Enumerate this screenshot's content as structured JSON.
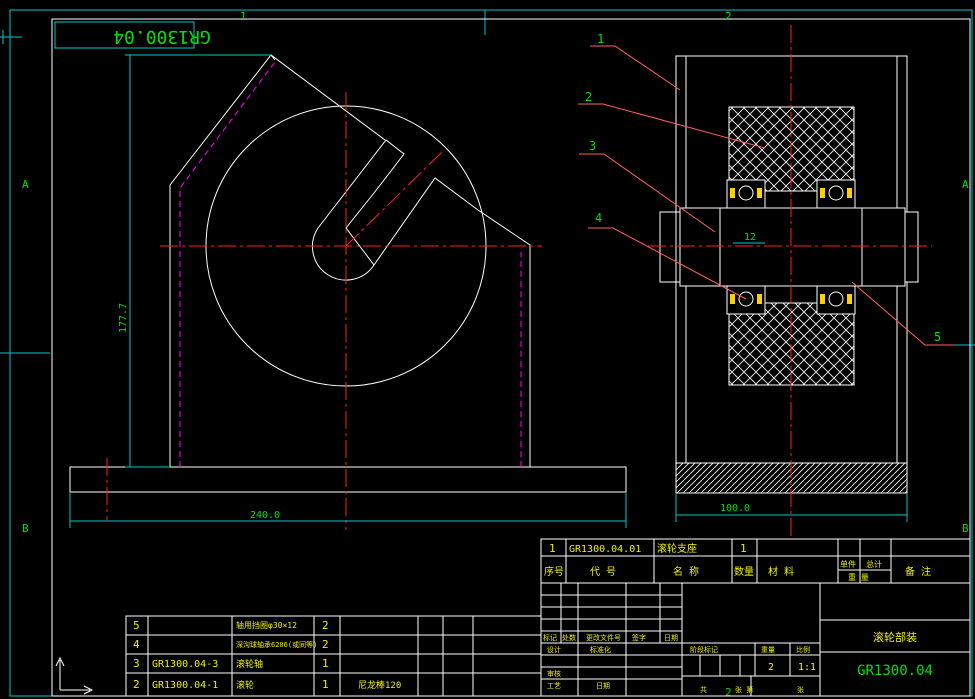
{
  "drawing": {
    "number": "GR1300.04",
    "number_mirrored": "GR1300.04",
    "title": "滚轮部装"
  },
  "zones": {
    "top": [
      "1",
      "2"
    ],
    "left": [
      "A",
      "B"
    ],
    "right": [
      "A",
      "B"
    ],
    "bottom": [
      "2"
    ]
  },
  "dimensions": {
    "base_width": "240.0",
    "height": "177.7",
    "roller_width": "100.0",
    "axle_offset": "12"
  },
  "callouts": [
    "1",
    "2",
    "3",
    "4",
    "5"
  ],
  "parts_list_upper": {
    "row": {
      "seq": "1",
      "code": "GR1300.04.01",
      "name": "滚轮支座",
      "qty": "1"
    },
    "headers": {
      "seq": "序号",
      "code": "代  号",
      "name": "名  称",
      "qty": "数量",
      "material": "材  料",
      "unit": "单件",
      "total": "总计",
      "weight": "重  量",
      "remark": "备  注"
    }
  },
  "parts_list_lower": [
    {
      "seq": "5",
      "code": "",
      "name": "轴用挡圈φ30×12",
      "qty": "2"
    },
    {
      "seq": "4",
      "code": "",
      "name": "深沟球轴承6206(或同等)",
      "qty": "2"
    },
    {
      "seq": "3",
      "code": "GR1300.04-3",
      "name": "滚轮轴",
      "qty": "1"
    },
    {
      "seq": "2",
      "code": "GR1300.04-1",
      "name": "滚轮",
      "qty": "1",
      "material": "尼龙棒120"
    }
  ],
  "title_block": {
    "rev_headers": [
      "标记",
      "处数",
      "更改文件号",
      "签字",
      "日期"
    ],
    "stage_label": "阶段标记",
    "weight_label": "重量",
    "scale_label": "比例",
    "weight_value": "2",
    "scale_value": "1:1",
    "sheets_label": "共",
    "sheet_label": "张 第",
    "sheet_end": "张",
    "roles": [
      "设计",
      "标准化",
      "审核",
      "工艺",
      "日期"
    ]
  },
  "colors": {
    "frame": "#ffffff",
    "centerline": "#ff2020",
    "dimension": "#00c8c8",
    "hidden": "#ff00ff",
    "text_yellow": "#f0f000",
    "text_green": "#00e000",
    "leader": "#ff6060",
    "bearing": "#ffd000"
  }
}
